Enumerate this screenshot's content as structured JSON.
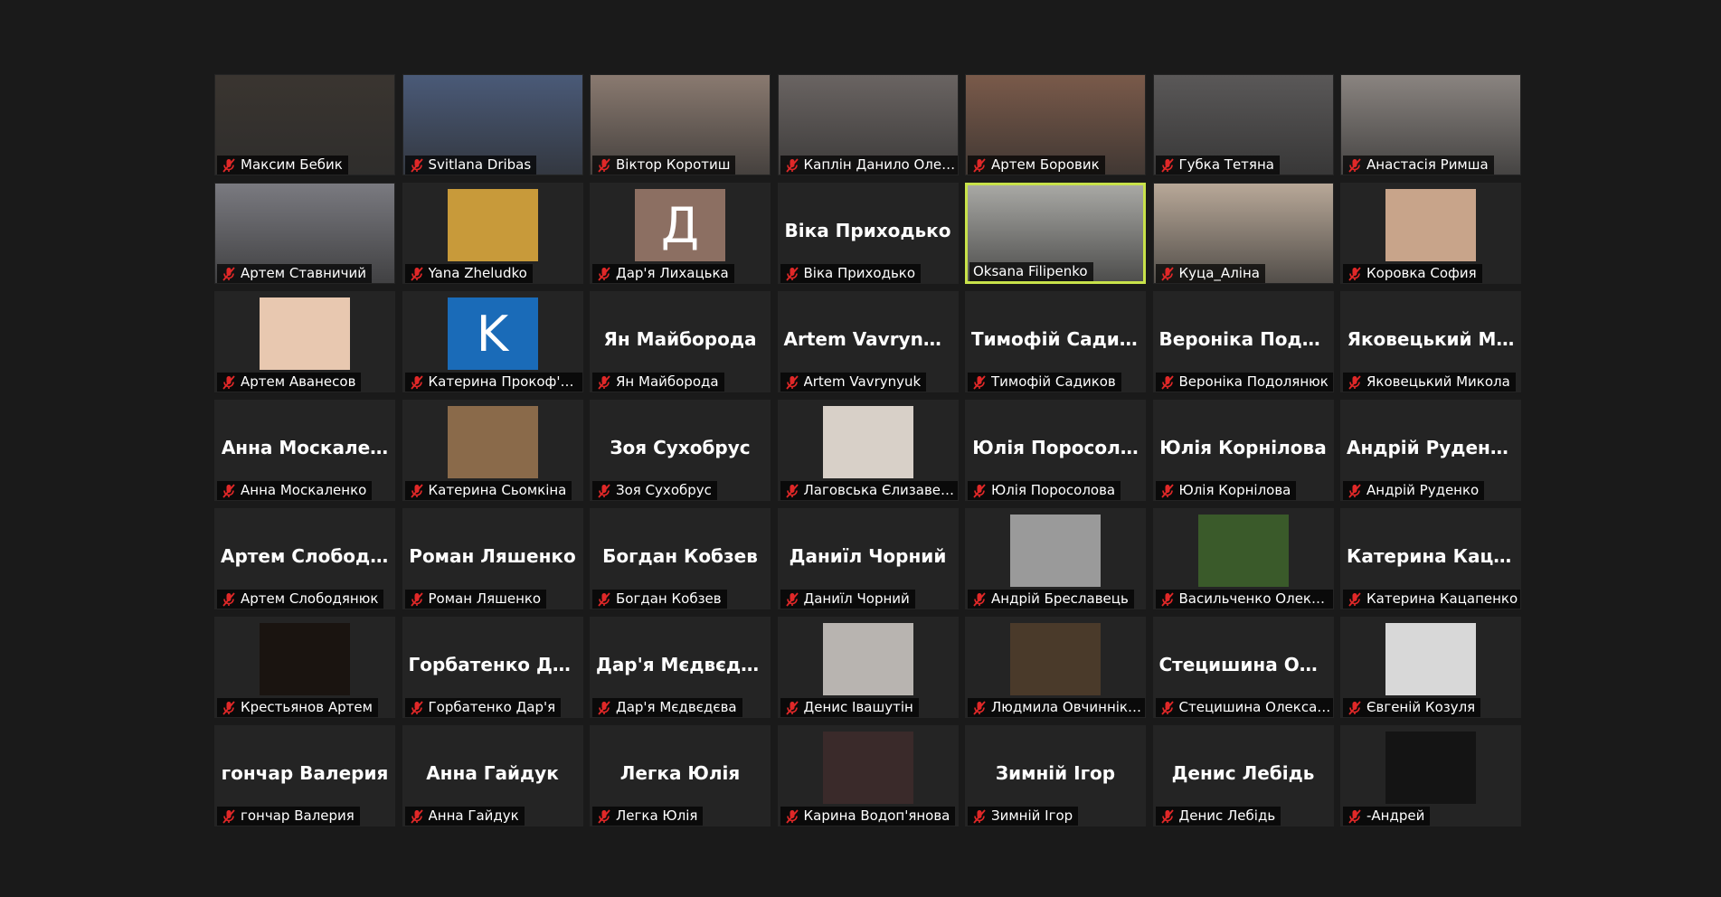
{
  "colors": {
    "background": "#1a1a1a",
    "tile": "#242424",
    "active_speaker_border": "#c8e24a",
    "muted_mic": "#e02828"
  },
  "grid": {
    "participants": [
      {
        "name": "Максим Бебик",
        "display": "video",
        "bg": "#3a3530",
        "muted": true
      },
      {
        "name": "Svitlana Dribas",
        "display": "video",
        "bg": "#4a5a78",
        "muted": true
      },
      {
        "name": "Віктор Коротиш",
        "display": "video",
        "bg": "#8a7a70",
        "muted": true
      },
      {
        "name": "Каплін Данило Олексі…",
        "display": "video",
        "bg": "#6a6462",
        "muted": true
      },
      {
        "name": "Артем Боровик",
        "display": "video",
        "bg": "#7a5a4a",
        "muted": true
      },
      {
        "name": "Губка Тетяна",
        "display": "video",
        "bg": "#5a5858",
        "muted": true
      },
      {
        "name": "Анастасія Римша",
        "display": "video",
        "bg": "#8a8480",
        "muted": true
      },
      {
        "name": "Артем Ставничий",
        "display": "video",
        "bg": "#7a7a80",
        "muted": true
      },
      {
        "name": "Yana Zheludko",
        "display": "avatar",
        "avatar_type": "photo",
        "bg": "#c89a3a",
        "muted": true
      },
      {
        "name": "Дар'я Лихацька",
        "display": "avatar",
        "avatar_type": "letter",
        "letter": "Д",
        "bg": "#8c6f62",
        "muted": true
      },
      {
        "name": "Віка Приходько",
        "display": "text",
        "big": "Віка Приходько",
        "muted": true
      },
      {
        "name": "Oksana Filipenko",
        "display": "video",
        "bg": "#a8a8a4",
        "muted": false,
        "active": true
      },
      {
        "name": "Куца_Аліна",
        "display": "video",
        "bg": "#b8a898",
        "muted": true
      },
      {
        "name": "Коровка София",
        "display": "avatar",
        "avatar_type": "photo",
        "bg": "#c8a48a",
        "muted": true
      },
      {
        "name": "Артем Аванесов",
        "display": "avatar",
        "avatar_type": "photo",
        "bg": "#e8c8b0",
        "muted": true
      },
      {
        "name": "Катерина Прокоф'єва",
        "display": "avatar",
        "avatar_type": "letter",
        "letter": "K",
        "bg": "#1a6bb8",
        "muted": true
      },
      {
        "name": "Ян Майборода",
        "display": "text",
        "big": "Ян Майборода",
        "muted": true
      },
      {
        "name": "Artem Vavrynyuk",
        "display": "text",
        "big": "Artem Vavrynyuk",
        "muted": true
      },
      {
        "name": "Тимофій Садиков",
        "display": "text",
        "big": "Тимофій Садик…",
        "muted": true
      },
      {
        "name": "Вероніка Подолянюк",
        "display": "text",
        "big": "Вероніка Подо…",
        "muted": true
      },
      {
        "name": "Яковецький Микола",
        "display": "text",
        "big": "Яковецький М…",
        "muted": true
      },
      {
        "name": "Анна Москаленко",
        "display": "text",
        "big": "Анна Москале…",
        "muted": true
      },
      {
        "name": "Катерина Сьомкіна",
        "display": "avatar",
        "avatar_type": "photo",
        "bg": "#8a6a4a",
        "muted": true
      },
      {
        "name": "Зоя Сухобрус",
        "display": "text",
        "big": "Зоя Сухобрус",
        "muted": true
      },
      {
        "name": "Лаговська Єлизавета",
        "display": "avatar",
        "avatar_type": "photo",
        "bg": "#d8d0c8",
        "muted": true
      },
      {
        "name": "Юлія Поросолова",
        "display": "text",
        "big": "Юлія Поросол…",
        "muted": true
      },
      {
        "name": "Юлія Корнілова",
        "display": "text",
        "big": "Юлія Корнілова",
        "muted": true
      },
      {
        "name": "Андрій Руденко",
        "display": "text",
        "big": "Андрій Руденко",
        "muted": true
      },
      {
        "name": "Артем Слободянюк",
        "display": "text",
        "big": "Артем Слободя…",
        "muted": true
      },
      {
        "name": "Роман Ляшенко",
        "display": "text",
        "big": "Роман Ляшенко",
        "muted": true
      },
      {
        "name": "Богдан Кобзев",
        "display": "text",
        "big": "Богдан Кобзев",
        "muted": true
      },
      {
        "name": "Даниїл Чорний",
        "display": "text",
        "big": "Даниїл Чорний",
        "muted": true
      },
      {
        "name": "Андрій Бреславець",
        "display": "avatar",
        "avatar_type": "photo",
        "bg": "#9a9a9a",
        "muted": true
      },
      {
        "name": "Васильченко Олексан…",
        "display": "avatar",
        "avatar_type": "photo",
        "bg": "#3a5a2a",
        "muted": true
      },
      {
        "name": "Катерина Кацапенко",
        "display": "text",
        "big": "Катерина Каца…",
        "muted": true
      },
      {
        "name": "Крестьянов Артем",
        "display": "avatar",
        "avatar_type": "photo",
        "bg": "#1a1410",
        "muted": true
      },
      {
        "name": "Горбатенко Дар'я",
        "display": "text",
        "big": "Горбатенко Да…",
        "muted": true
      },
      {
        "name": "Дар'я Мєдвєдєва",
        "display": "text",
        "big": "Дар'я Мєдвєдєва",
        "muted": true
      },
      {
        "name": "Денис Івашутін",
        "display": "avatar",
        "avatar_type": "photo",
        "bg": "#b8b4b0",
        "muted": true
      },
      {
        "name": "Людмила Овчиннікова",
        "display": "avatar",
        "avatar_type": "photo",
        "bg": "#4a3a2a",
        "muted": true
      },
      {
        "name": "Стецишина Олександ…",
        "display": "text",
        "big": "Стецишина Ол…",
        "muted": true
      },
      {
        "name": "Євгеній Козуля",
        "display": "avatar",
        "avatar_type": "photo",
        "bg": "#d8d8d8",
        "muted": true
      },
      {
        "name": "гончар Валерия",
        "display": "text",
        "big": "гончар Валерия",
        "muted": true
      },
      {
        "name": "Анна Гайдук",
        "display": "text",
        "big": "Анна Гайдук",
        "muted": true
      },
      {
        "name": "Легка Юлія",
        "display": "text",
        "big": "Легка Юлія",
        "muted": true
      },
      {
        "name": "Карина Водоп'янова",
        "display": "avatar",
        "avatar_type": "photo",
        "bg": "#3a2a2a",
        "muted": true
      },
      {
        "name": "Зимній Ігор",
        "display": "text",
        "big": "Зимній Ігор",
        "muted": true
      },
      {
        "name": "Денис Лебідь",
        "display": "text",
        "big": "Денис Лебідь",
        "muted": true
      },
      {
        "name": "-Андрей",
        "display": "avatar",
        "avatar_type": "photo",
        "bg": "#141414",
        "muted": true
      }
    ]
  }
}
